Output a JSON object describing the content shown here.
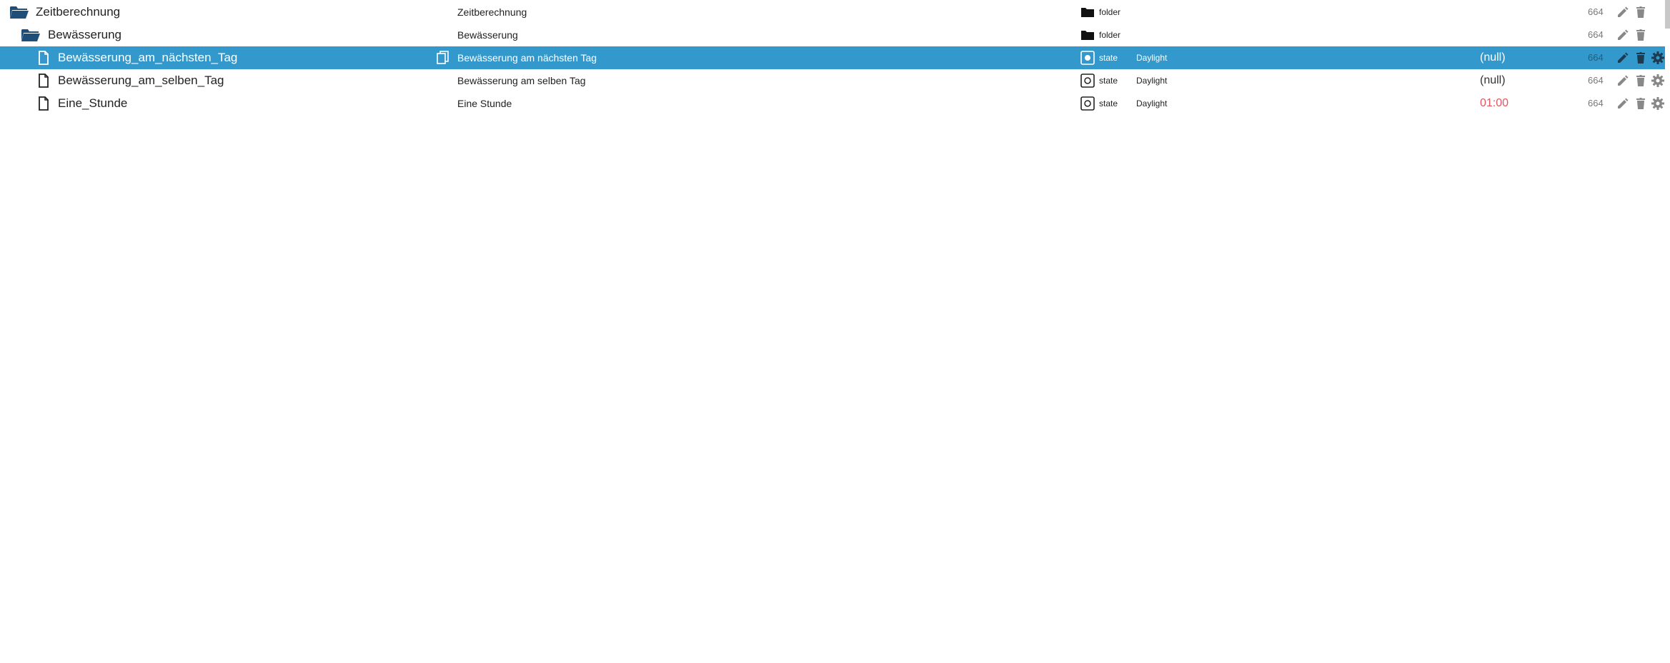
{
  "rows": [
    {
      "id": "Zeitberechnung",
      "name": "Zeitberechnung",
      "type": "folder",
      "type_icon": "folder-icon",
      "role": "",
      "value": "",
      "acl": "664",
      "depth": 0,
      "kind": "folder-open"
    },
    {
      "id": "Bewässerung",
      "name": "Bewässerung",
      "type": "folder",
      "type_icon": "folder-icon",
      "role": "",
      "value": "",
      "acl": "664",
      "depth": 1,
      "kind": "folder-open"
    },
    {
      "id": "Bewässerung_am_nächsten_Tag",
      "name": "Bewässerung am nächsten Tag",
      "type": "state",
      "type_icon": "state-icon",
      "role": "Daylight",
      "value": "(null)",
      "acl": "664",
      "depth": 2,
      "kind": "file",
      "selected": true
    },
    {
      "id": "Bewässerung_am_selben_Tag",
      "name": "Bewässerung am selben Tag",
      "type": "state",
      "type_icon": "state-icon",
      "role": "Daylight",
      "value": "(null)",
      "acl": "664",
      "depth": 2,
      "kind": "file"
    },
    {
      "id": "Eine_Stunde",
      "name": "Eine Stunde",
      "type": "state",
      "type_icon": "state-icon",
      "role": "Daylight",
      "value": "01:00",
      "acl": "664",
      "depth": 2,
      "kind": "file"
    }
  ],
  "colors": {
    "selected_row": "#3399cc",
    "folder_icon": "#1f4e79",
    "value_time": "#e0575f",
    "action_icon": "#888888"
  },
  "icons": {
    "edit": "pencil-icon",
    "delete": "trash-icon",
    "config": "gear-icon",
    "copy": "copy-icon"
  }
}
